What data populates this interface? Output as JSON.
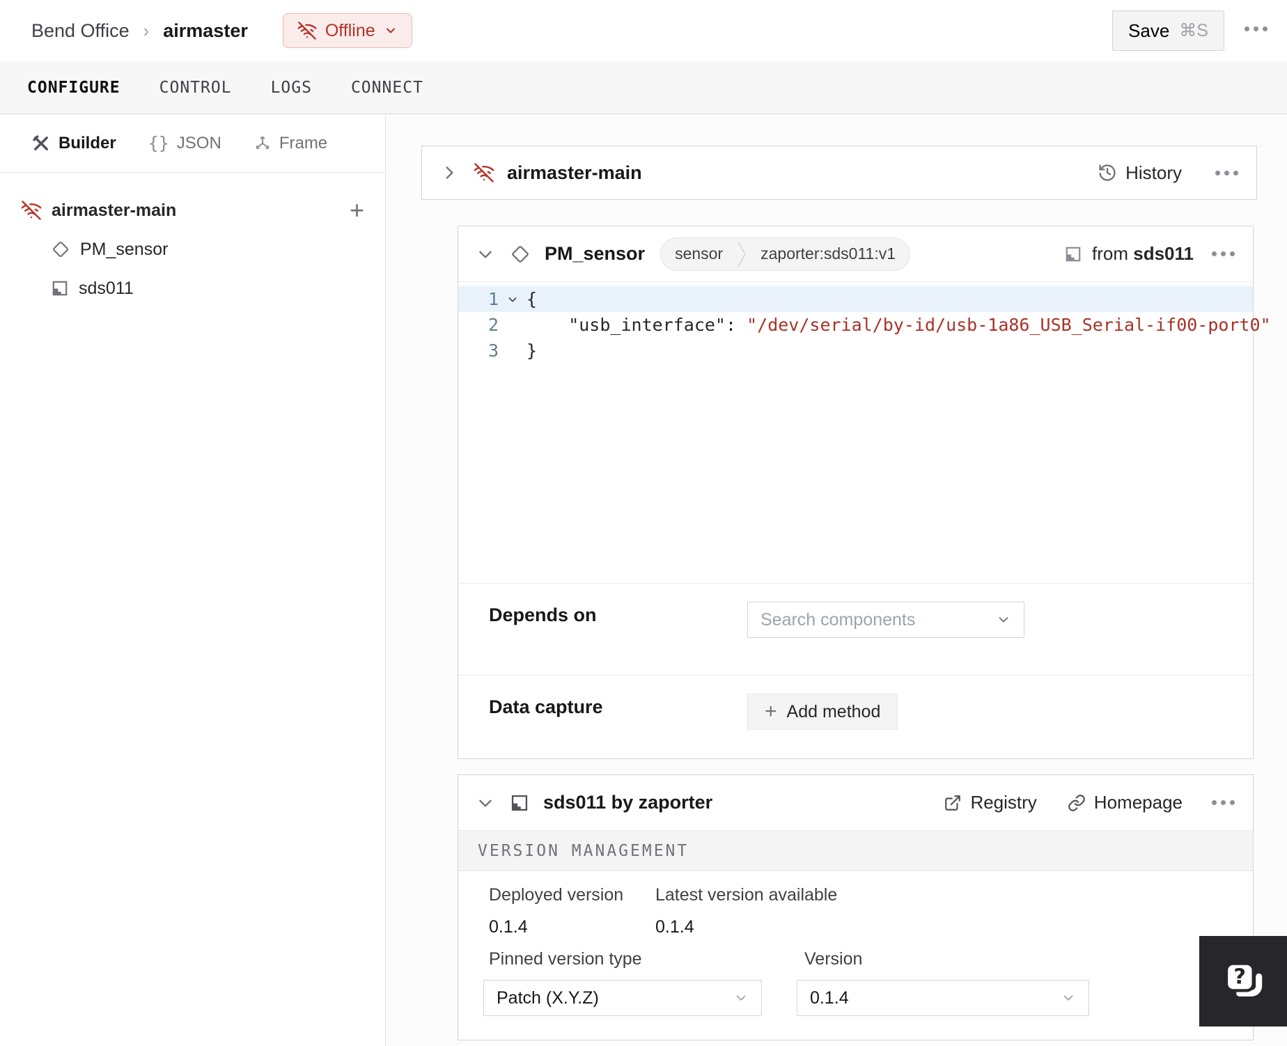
{
  "header": {
    "breadcrumb": {
      "org": "Bend Office",
      "sep": "›",
      "machine": "airmaster"
    },
    "status": {
      "label": "Offline"
    },
    "save": {
      "label": "Save",
      "shortcut": "⌘S"
    }
  },
  "tabs": {
    "items": [
      {
        "label": "CONFIGURE",
        "active": true
      },
      {
        "label": "CONTROL",
        "active": false
      },
      {
        "label": "LOGS",
        "active": false
      },
      {
        "label": "CONNECT",
        "active": false
      }
    ]
  },
  "sidebar": {
    "modes": [
      {
        "label": "Builder"
      },
      {
        "label": "JSON",
        "glyph": "{}"
      },
      {
        "label": "Frame"
      }
    ],
    "add_label": "+",
    "tree": [
      {
        "label": "airmaster-main",
        "type": "machine-part-offline"
      },
      {
        "label": "PM_sensor",
        "type": "component"
      },
      {
        "label": "sds011",
        "type": "module"
      }
    ]
  },
  "part_card": {
    "title": "airmaster-main",
    "history_label": "History"
  },
  "component_card": {
    "title": "PM_sensor",
    "type_badge": "sensor",
    "model_badge": "zaporter:sds011:v1",
    "from_prefix": "from",
    "from_module": "sds011",
    "editor": {
      "l1": {
        "num": "1",
        "text": "{"
      },
      "l2": {
        "num": "2",
        "key": "    \"usb_interface\"",
        "colon": ": ",
        "value": "\"/dev/serial/by-id/usb-1a86_USB_Serial-if00-port0\""
      },
      "l3": {
        "num": "3",
        "text": "}"
      }
    },
    "depends_on": {
      "label": "Depends on",
      "placeholder": "Search components"
    },
    "data_capture": {
      "label": "Data capture",
      "plus": "+",
      "button_label": "Add method"
    }
  },
  "module_card": {
    "title": "sds011 by zaporter",
    "registry_label": "Registry",
    "homepage_label": "Homepage",
    "version_management": {
      "heading": "VERSION MANAGEMENT",
      "deployed": {
        "label": "Deployed version",
        "value": "0.1.4"
      },
      "latest": {
        "label": "Latest version available",
        "value": "0.1.4"
      },
      "pinned": {
        "label": "Pinned version type",
        "value": "Patch (X.Y.Z)"
      },
      "version": {
        "label": "Version",
        "value": "0.1.4"
      }
    }
  },
  "colors": {
    "accent_red": "#b8342c",
    "badge_bg": "#faeceb",
    "string_red": "#a93226",
    "help_bg": "#26262b"
  }
}
